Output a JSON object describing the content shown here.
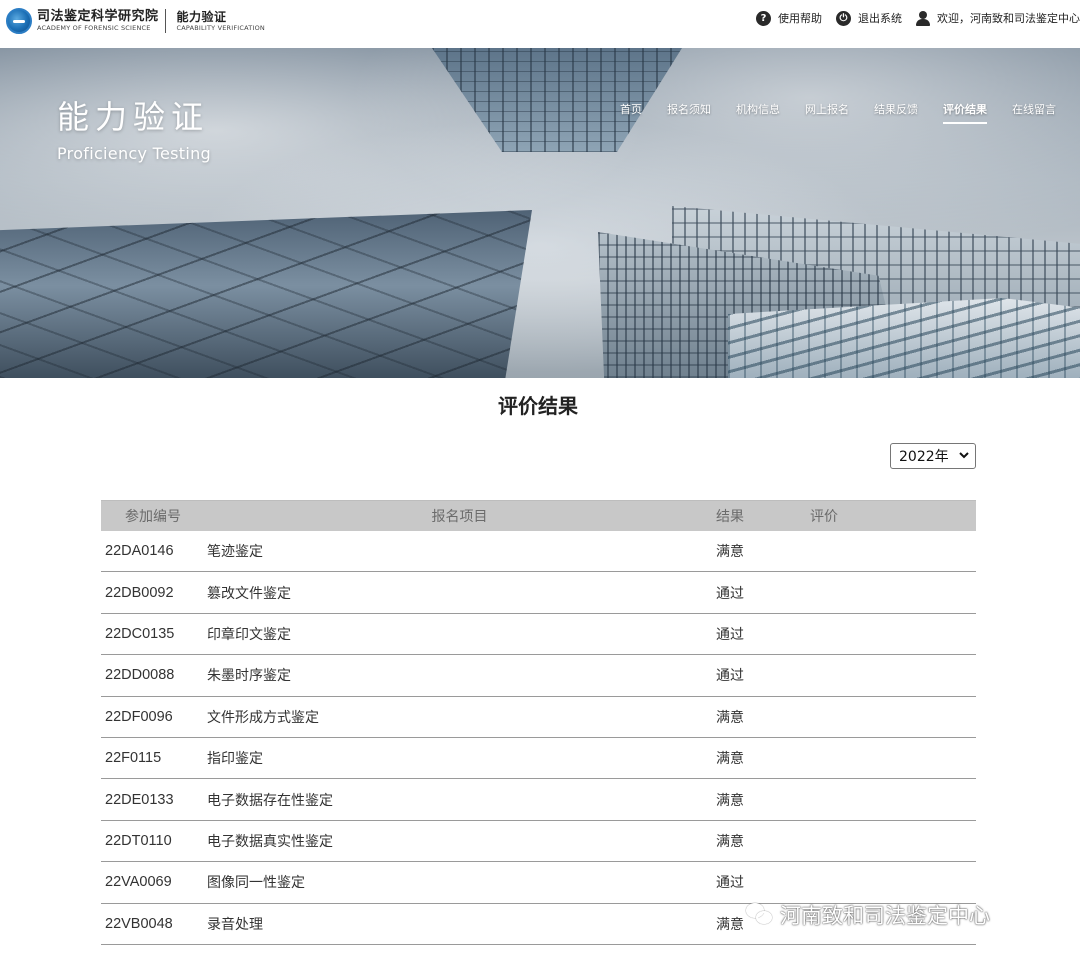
{
  "header": {
    "logo_cn": "司法鉴定科学研究院",
    "logo_en": "ACADEMY OF FORENSIC SCIENCE",
    "logo_sub_cn": "能力验证",
    "logo_sub_en": "CAPABILITY VERIFICATION",
    "help_label": "使用帮助",
    "logout_label": "退出系统",
    "welcome_text": "欢迎，河南致和司法鉴定中心"
  },
  "banner": {
    "title_cn": "能力验证",
    "title_en": "Proficiency Testing"
  },
  "nav": {
    "items": [
      {
        "label": "首页"
      },
      {
        "label": "报名须知"
      },
      {
        "label": "机构信息"
      },
      {
        "label": "网上报名"
      },
      {
        "label": "结果反馈"
      },
      {
        "label": "评价结果"
      },
      {
        "label": "在线留言"
      }
    ],
    "active_index": 5
  },
  "main": {
    "title": "评价结果",
    "year_selected": "2022年"
  },
  "table": {
    "headers": [
      "参加编号",
      "报名项目",
      "结果",
      "评价"
    ],
    "rows": [
      {
        "id": "22DA0146",
        "project": "笔迹鉴定",
        "result": "满意",
        "comment": ""
      },
      {
        "id": "22DB0092",
        "project": "篡改文件鉴定",
        "result": "通过",
        "comment": ""
      },
      {
        "id": "22DC0135",
        "project": "印章印文鉴定",
        "result": "通过",
        "comment": ""
      },
      {
        "id": "22DD0088",
        "project": "朱墨时序鉴定",
        "result": "通过",
        "comment": ""
      },
      {
        "id": "22DF0096",
        "project": "文件形成方式鉴定",
        "result": "满意",
        "comment": ""
      },
      {
        "id": "22F0115",
        "project": "指印鉴定",
        "result": "满意",
        "comment": ""
      },
      {
        "id": "22DE0133",
        "project": "电子数据存在性鉴定",
        "result": "满意",
        "comment": ""
      },
      {
        "id": "22DT0110",
        "project": "电子数据真实性鉴定",
        "result": "满意",
        "comment": ""
      },
      {
        "id": "22VA0069",
        "project": "图像同一性鉴定",
        "result": "通过",
        "comment": ""
      },
      {
        "id": "22VB0048",
        "project": "录音处理",
        "result": "满意",
        "comment": ""
      }
    ]
  },
  "watermark": {
    "text": "河南致和司法鉴定中心"
  }
}
